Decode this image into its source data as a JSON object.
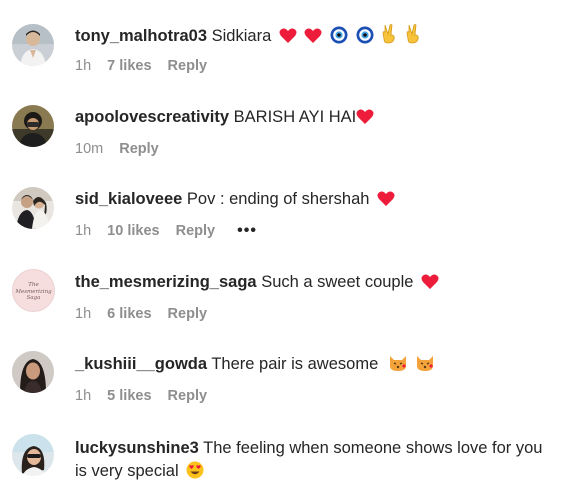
{
  "comments": [
    {
      "username": "tony_malhotra03",
      "text": "Sidkiara",
      "emojis": [
        "heart-emoji",
        "heart-emoji",
        "nazar-emoji",
        "nazar-emoji",
        "victory-hand-emoji",
        "victory-hand-emoji"
      ],
      "time": "1h",
      "likes": "7 likes",
      "reply": "Reply"
    },
    {
      "username": "apoolovescreativity",
      "text": "BARISH AYI HAI",
      "emojis": [
        "heart-emoji"
      ],
      "time": "10m",
      "likes": "",
      "reply": "Reply"
    },
    {
      "username": "sid_kialoveee",
      "text": "Pov : ending of shershah",
      "emojis": [
        "heart-emoji"
      ],
      "time": "1h",
      "likes": "10 likes",
      "reply": "Reply",
      "more": "•••"
    },
    {
      "username": "the_mesmerizing_saga",
      "text": "Such a sweet couple",
      "emojis": [
        "heart-emoji"
      ],
      "time": "1h",
      "likes": "6 likes",
      "reply": "Reply",
      "avatar_text": "The Mesmerizing Saga"
    },
    {
      "username": "_kushiii__gowda",
      "text": "There pair is awesome",
      "emojis": [
        "kissing-cat-emoji",
        "kissing-cat-emoji"
      ],
      "time": "1h",
      "likes": "5 likes",
      "reply": "Reply"
    },
    {
      "username": "luckysunshine3",
      "text_line1": "The feeling when someone shows love for you",
      "text_line2": "is very special",
      "emojis": [
        "heart-eyes-emoji"
      ]
    }
  ],
  "colors": {
    "text": "#262626",
    "meta": "#8e8e8e",
    "heart": "#ed1c3a",
    "nazar": "#1565c0"
  }
}
